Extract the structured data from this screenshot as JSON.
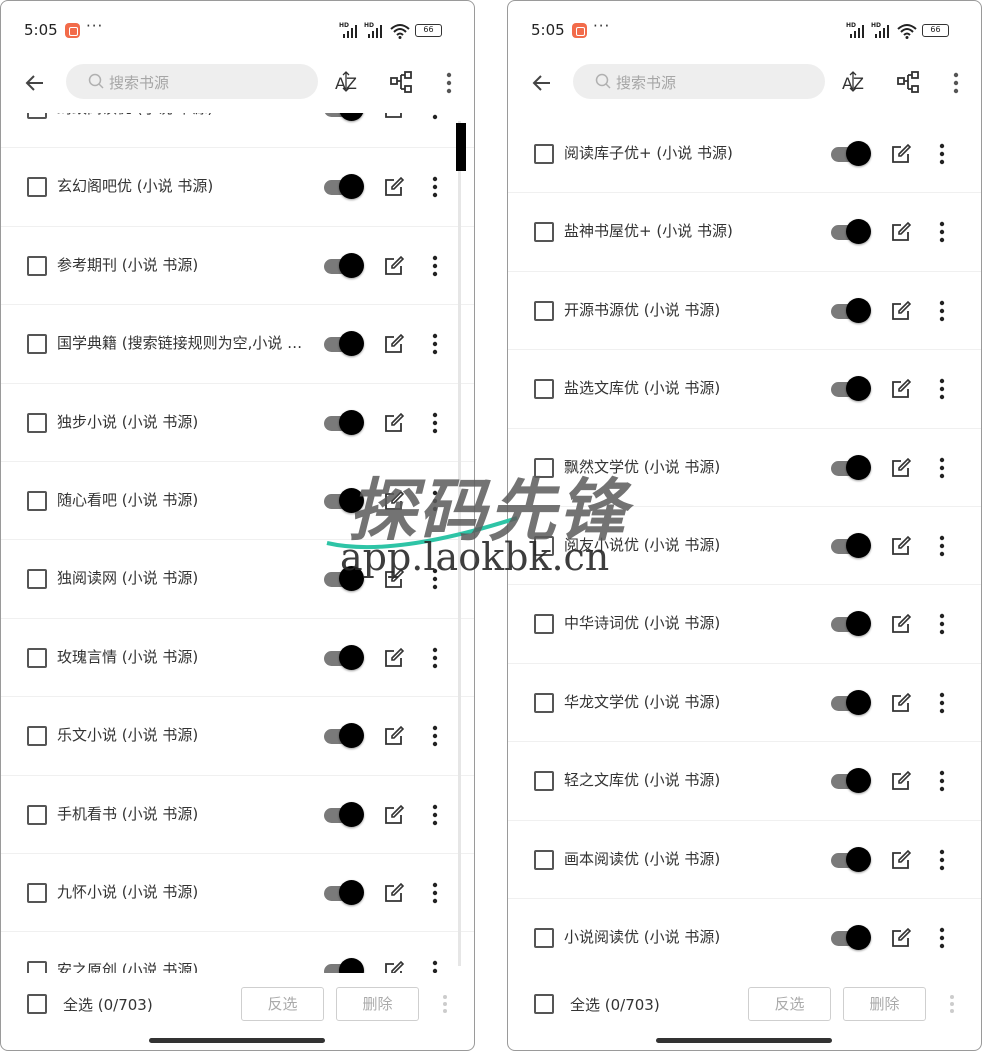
{
  "status_bar": {
    "time": "5:05",
    "overflow": "···",
    "network_left": "HD",
    "network_right": "HD",
    "battery": "66"
  },
  "toolbar": {
    "search_placeholder": "搜索书源",
    "back_icon": "arrow-left-icon",
    "sort_icon": "sort-az-icon",
    "group_icon": "group-icon",
    "more_icon": "more-vert-icon"
  },
  "left_screen": {
    "items": [
      {
        "label": "蚂蚁阅读优 (小说 书源)",
        "enabled": true
      },
      {
        "label": "玄幻阁吧优 (小说 书源)",
        "enabled": true
      },
      {
        "label": "参考期刊 (小说 书源)",
        "enabled": true
      },
      {
        "label": "国学典籍 (搜索链接规则为空,小说 书源)",
        "enabled": true
      },
      {
        "label": "独步小说 (小说 书源)",
        "enabled": true
      },
      {
        "label": "随心看吧 (小说 书源)",
        "enabled": true
      },
      {
        "label": "独阅读网 (小说 书源)",
        "enabled": true
      },
      {
        "label": "玫瑰言情 (小说 书源)",
        "enabled": true
      },
      {
        "label": "乐文小说 (小说 书源)",
        "enabled": true
      },
      {
        "label": "手机看书 (小说 书源)",
        "enabled": true
      },
      {
        "label": "九怀小说 (小说 书源)",
        "enabled": true
      },
      {
        "label": "安之原创 (小说 书源)",
        "enabled": true
      }
    ]
  },
  "right_screen": {
    "items": [
      {
        "label": "阅读库子优+ (小说 书源)",
        "enabled": true
      },
      {
        "label": "盐神书屋优+ (小说 书源)",
        "enabled": true
      },
      {
        "label": "开源书源优 (小说 书源)",
        "enabled": true
      },
      {
        "label": "盐选文库优 (小说 书源)",
        "enabled": true
      },
      {
        "label": "飘然文学优 (小说 书源)",
        "enabled": true
      },
      {
        "label": "阅友小说优 (小说 书源)",
        "enabled": true
      },
      {
        "label": "中华诗词优 (小说 书源)",
        "enabled": true
      },
      {
        "label": "华龙文学优 (小说 书源)",
        "enabled": true
      },
      {
        "label": "轻之文库优 (小说 书源)",
        "enabled": true
      },
      {
        "label": "画本阅读优 (小说 书源)",
        "enabled": true
      },
      {
        "label": "小说阅读优 (小说 书源)",
        "enabled": true
      }
    ]
  },
  "bottom_bar": {
    "select_all": "全选 (0/703)",
    "invert_label": "反选",
    "delete_label": "删除"
  },
  "watermark": {
    "brand": "探码先锋",
    "url": "app.laokbk.cn"
  }
}
